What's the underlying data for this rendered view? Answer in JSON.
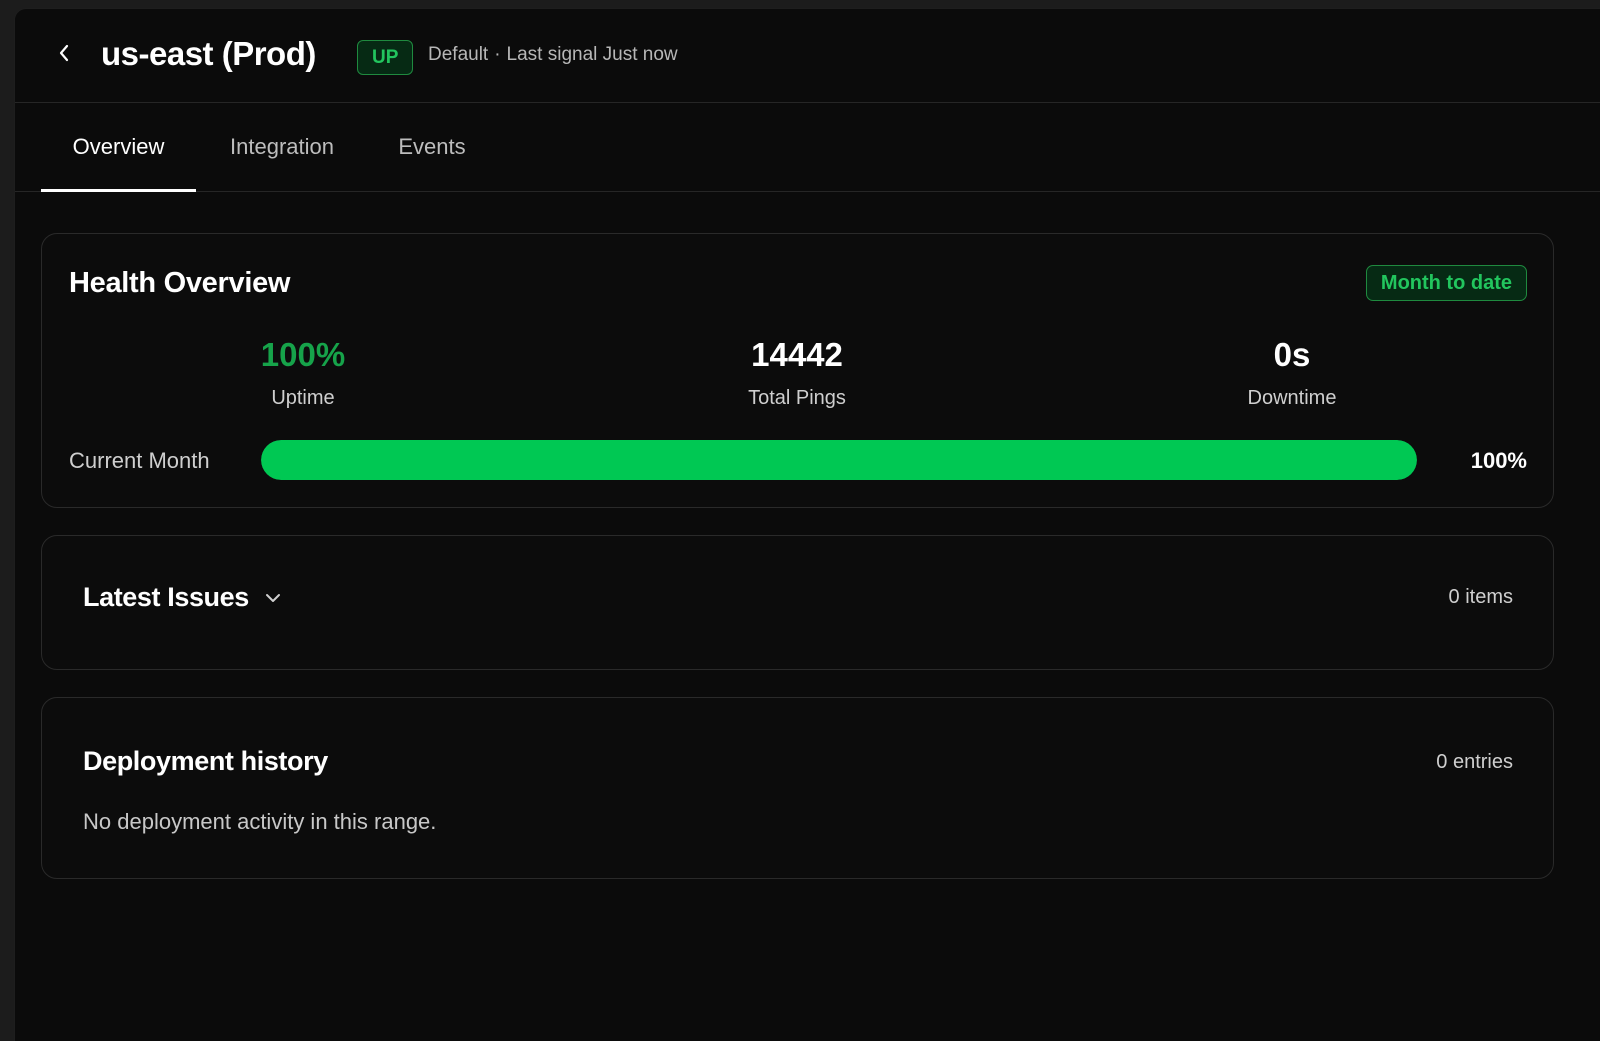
{
  "header": {
    "title": "us-east (Prod)",
    "status": "UP",
    "environment": "Default",
    "separator": "·",
    "last_signal": "Last signal Just now"
  },
  "tabs": [
    {
      "label": "Overview",
      "active": true
    },
    {
      "label": "Integration",
      "active": false
    },
    {
      "label": "Events",
      "active": false
    }
  ],
  "health": {
    "title": "Health Overview",
    "range_label": "Month to date",
    "stats": {
      "uptime": {
        "value": "100%",
        "label": "Uptime"
      },
      "pings": {
        "value": "14442",
        "label": "Total Pings"
      },
      "downtime": {
        "value": "0s",
        "label": "Downtime"
      }
    },
    "bar": {
      "label": "Current Month",
      "percent": 100,
      "percent_text": "100%"
    }
  },
  "issues": {
    "title": "Latest Issues",
    "count_text": "0 items"
  },
  "deployments": {
    "title": "Deployment history",
    "count_text": "0 entries",
    "empty_text": "No deployment activity in this range."
  },
  "colors": {
    "accent_green": "#22c55e",
    "bar_green": "#00c853",
    "background": "#0b0b0b"
  },
  "icons": {
    "back": "chevron-left-icon",
    "expand": "chevron-down-icon"
  }
}
